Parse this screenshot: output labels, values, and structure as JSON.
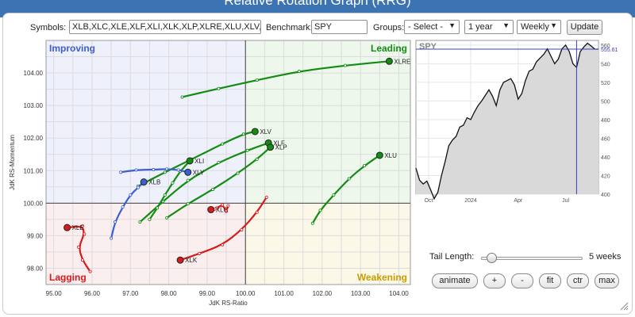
{
  "page": {
    "title": "Relative Rotation Graph (RRG)"
  },
  "controls": {
    "symbols_label": "Symbols:",
    "symbols_value": "XLB,XLC,XLE,XLF,XLI,XLK,XLP,XLRE,XLU,XLV,XLY",
    "benchmark_label": "Benchmark:",
    "benchmark_value": "SPY",
    "groups_label": "Groups:",
    "groups_value": "- Select -",
    "period_value": "1 year",
    "frequency_value": "Weekly",
    "update_label": "Update"
  },
  "bottom_controls": {
    "tail_length_label": "Tail Length:",
    "tail_length_value": "5 weeks",
    "tail_length_fraction": 0.1,
    "buttons": [
      "animate",
      "+",
      "-",
      "fit",
      "ctr",
      "max"
    ]
  },
  "colors": {
    "leading": "#128c12",
    "improving": "#3c5fd1",
    "lagging": "#d91a1a",
    "weakening": "#c99b00",
    "benchmark_line": "#3c3cc8"
  },
  "chart_data": [
    {
      "type": "scatter",
      "subtype": "relative-rotation-graph",
      "title": "",
      "xlabel": "JdK RS-Ratio",
      "ylabel": "JdK RS-Momentum",
      "xlim": [
        94.8,
        104.3
      ],
      "ylim": [
        97.5,
        105.0
      ],
      "x_ticks": [
        "95.00",
        "96.00",
        "97.00",
        "98.00",
        "99.00",
        "100.00",
        "101.00",
        "102.00",
        "103.00",
        "104.00"
      ],
      "y_ticks": [
        "98.00",
        "99.00",
        "100.00",
        "101.00",
        "102.00",
        "103.00",
        "104.00"
      ],
      "center": [
        100,
        100
      ],
      "quadrants": [
        {
          "name": "Improving",
          "position": "top-left",
          "color": "#3c5fd1"
        },
        {
          "name": "Leading",
          "position": "top-right",
          "color": "#128c12"
        },
        {
          "name": "Lagging",
          "position": "bottom-left",
          "color": "#d91a1a"
        },
        {
          "name": "Weakening",
          "position": "bottom-right",
          "color": "#c99b00"
        }
      ],
      "grid": true,
      "series": [
        {
          "name": "XLRE",
          "color": "#128c12",
          "tail": [
            [
              98.35,
              103.26
            ],
            [
              99.3,
              103.52
            ],
            [
              100.3,
              103.78
            ],
            [
              101.4,
              104.05
            ],
            [
              102.6,
              104.23
            ],
            [
              103.75,
              104.36
            ]
          ],
          "label_side": "right"
        },
        {
          "name": "XLV",
          "color": "#128c12",
          "tail": [
            [
              97.2,
              100.52
            ],
            [
              97.9,
              100.95
            ],
            [
              98.6,
              101.35
            ],
            [
              99.4,
              101.82
            ],
            [
              99.95,
              102.12
            ],
            [
              100.25,
              102.2
            ]
          ],
          "label_side": "right"
        },
        {
          "name": "XLF",
          "color": "#128c12",
          "tail": [
            [
              97.25,
              99.42
            ],
            [
              97.85,
              100.05
            ],
            [
              98.5,
              100.7
            ],
            [
              99.3,
              101.25
            ],
            [
              100.05,
              101.62
            ],
            [
              100.6,
              101.85
            ]
          ],
          "label_side": "right"
        },
        {
          "name": "XLP",
          "color": "#128c12",
          "tail": [
            [
              97.95,
              99.55
            ],
            [
              98.5,
              99.98
            ],
            [
              99.15,
              100.42
            ],
            [
              99.8,
              100.92
            ],
            [
              100.3,
              101.35
            ],
            [
              100.65,
              101.72
            ]
          ],
          "label_side": "right"
        },
        {
          "name": "XLU",
          "color": "#128c12",
          "tail": [
            [
              101.75,
              99.38
            ],
            [
              101.95,
              99.78
            ],
            [
              102.3,
              100.25
            ],
            [
              102.7,
              100.75
            ],
            [
              103.1,
              101.15
            ],
            [
              103.5,
              101.47
            ]
          ],
          "label_side": "right"
        },
        {
          "name": "XLI",
          "color": "#128c12",
          "tail": [
            [
              97.5,
              99.5
            ],
            [
              97.7,
              99.85
            ],
            [
              97.9,
              100.25
            ],
            [
              98.1,
              100.62
            ],
            [
              98.3,
              100.98
            ],
            [
              98.55,
              101.3
            ]
          ],
          "label_side": "right"
        },
        {
          "name": "XLY",
          "color": "#3c5fd1",
          "tail": [
            [
              96.75,
              100.95
            ],
            [
              97.15,
              101.02
            ],
            [
              97.6,
              101.03
            ],
            [
              97.95,
              101.05
            ],
            [
              98.25,
              101.02
            ],
            [
              98.5,
              100.95
            ]
          ],
          "label_side": "right"
        },
        {
          "name": "XLB",
          "color": "#3c5fd1",
          "tail": [
            [
              96.5,
              98.92
            ],
            [
              96.6,
              99.42
            ],
            [
              96.8,
              99.88
            ],
            [
              97.0,
              100.25
            ],
            [
              97.2,
              100.48
            ],
            [
              97.35,
              100.65
            ]
          ],
          "label_side": "right"
        },
        {
          "name": "XLK",
          "color": "#d91a1a",
          "tail": [
            [
              100.55,
              100.18
            ],
            [
              100.3,
              99.72
            ],
            [
              99.9,
              99.18
            ],
            [
              99.4,
              98.72
            ],
            [
              98.8,
              98.45
            ],
            [
              98.3,
              98.25
            ]
          ],
          "label_side": "right"
        },
        {
          "name": "XLE",
          "color": "#d91a1a",
          "tail": [
            [
              95.95,
              97.9
            ],
            [
              95.75,
              98.25
            ],
            [
              95.65,
              98.65
            ],
            [
              95.8,
              99.05
            ],
            [
              95.75,
              99.3
            ],
            [
              95.35,
              99.25
            ]
          ],
          "label_side": "right"
        },
        {
          "name": "XLC",
          "color": "#d91a1a",
          "tail": [
            [
              99.55,
              99.92
            ],
            [
              99.5,
              99.75
            ],
            [
              99.4,
              99.95
            ],
            [
              99.25,
              99.85
            ],
            [
              99.2,
              99.82
            ],
            [
              99.1,
              99.8
            ]
          ],
          "label_side": "right"
        }
      ]
    },
    {
      "type": "area",
      "title": "SPY",
      "xlim_labels": [
        "Oct",
        "2024",
        "Apr",
        "Jul"
      ],
      "ylim": [
        400,
        565
      ],
      "y_ticks": [
        400,
        420,
        440,
        460,
        480,
        500,
        520,
        540,
        560
      ],
      "current_value_label": "555.61",
      "current_value": 555.61,
      "series": [
        {
          "values": [
            428,
            415,
            411,
            414,
            405,
            395,
            402,
            420,
            435,
            452,
            458,
            462,
            472,
            474,
            482,
            480,
            488,
            495,
            500,
            506,
            512,
            505,
            495,
            512,
            520,
            522,
            524,
            517,
            502,
            508,
            522,
            532,
            534,
            542,
            546,
            550,
            556,
            548,
            540,
            545,
            556,
            560,
            553,
            540,
            536,
            553,
            558,
            562,
            559,
            555.61,
            555.61
          ]
        }
      ]
    }
  ]
}
